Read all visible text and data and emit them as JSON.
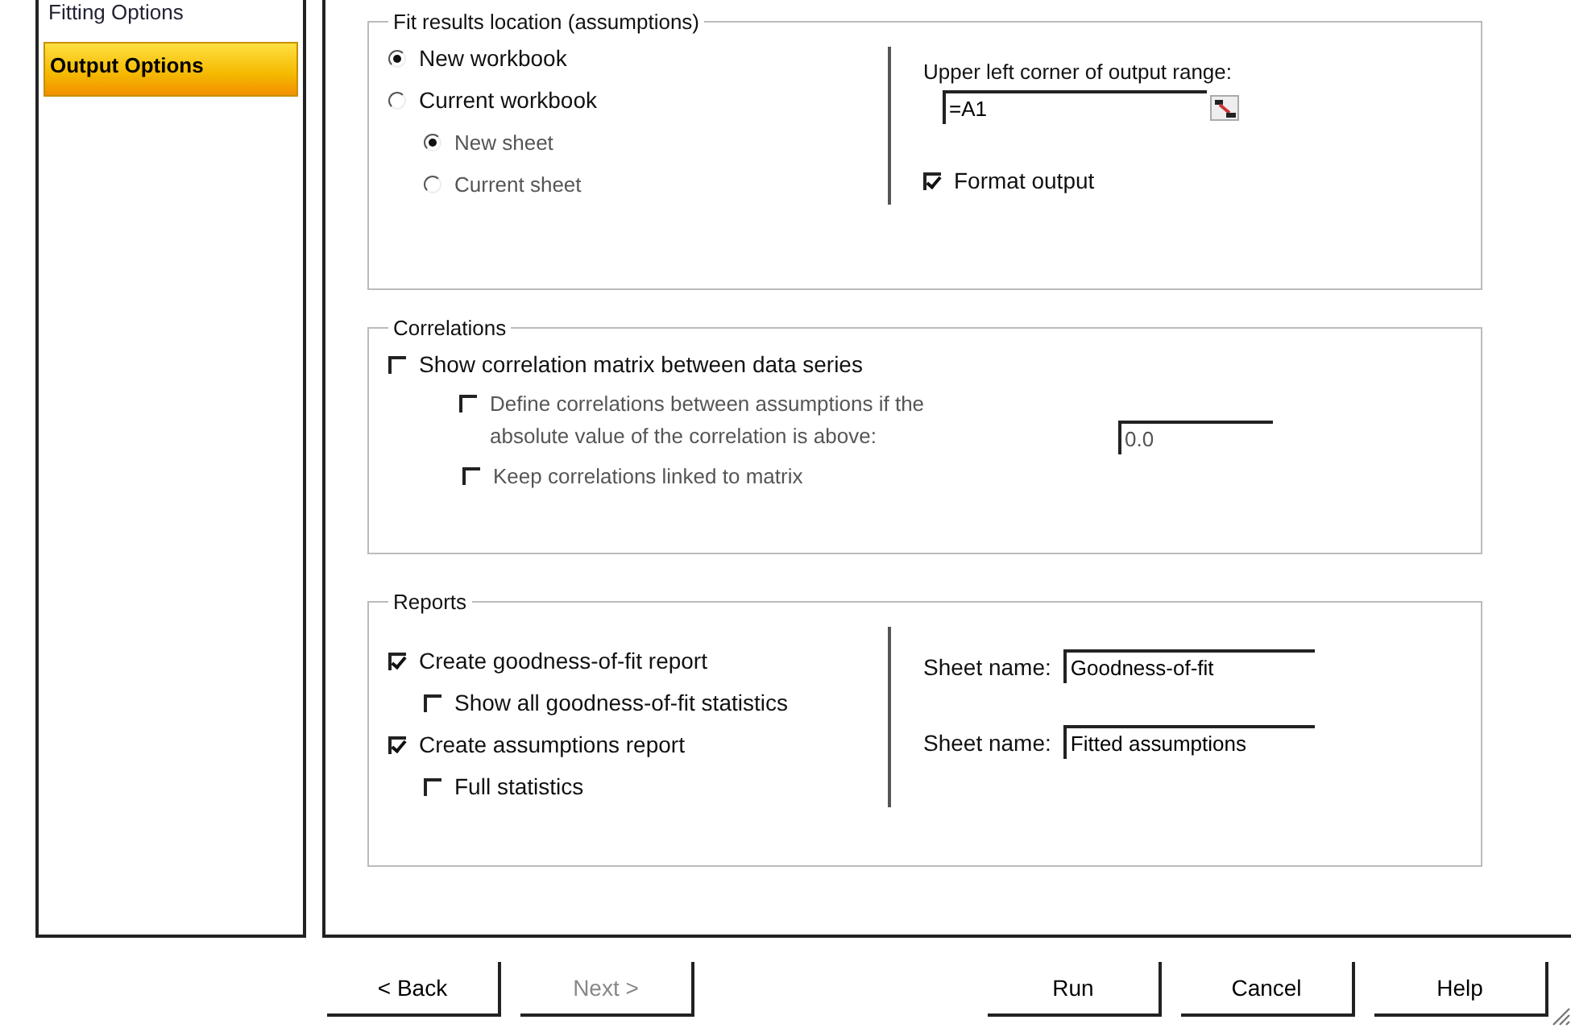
{
  "sidebar": {
    "items": [
      {
        "label": "Fitting Options",
        "selected": false
      },
      {
        "label": "Output Options",
        "selected": true
      }
    ]
  },
  "fit_results": {
    "title": "Fit results location (assumptions)",
    "location_options": [
      {
        "label": "New workbook",
        "selected": true
      },
      {
        "label": "Current workbook",
        "selected": false
      }
    ],
    "sheet_options": [
      {
        "label": "New sheet",
        "selected": true
      },
      {
        "label": "Current sheet",
        "selected": false
      }
    ],
    "range_label": "Upper left corner of output range:",
    "range_value": "=A1",
    "format_output": {
      "label": "Format output",
      "checked": true
    }
  },
  "correlations": {
    "title": "Correlations",
    "show_matrix": {
      "label": "Show correlation matrix between data series",
      "checked": false,
      "disabled": false
    },
    "define": {
      "label": "Define correlations between assumptions if the absolute value of the correlation is above:",
      "checked": false,
      "disabled": true
    },
    "threshold_value": "0.0",
    "keep_linked": {
      "label": "Keep correlations linked to matrix",
      "checked": false,
      "disabled": true
    }
  },
  "reports": {
    "title": "Reports",
    "items": [
      {
        "label": "Create goodness-of-fit report",
        "checked": true,
        "sheet_label": "Sheet name:",
        "sheet_value": "Goodness-of-fit",
        "children": [
          {
            "label": "Show all goodness-of-fit statistics",
            "checked": false
          }
        ]
      },
      {
        "label": "Create assumptions report",
        "checked": true,
        "sheet_label": "Sheet name:",
        "sheet_value": "Fitted assumptions",
        "children": [
          {
            "label": "Full statistics",
            "checked": false
          }
        ]
      }
    ]
  },
  "buttons": [
    {
      "label": "< Back",
      "disabled": false,
      "kind": "nav"
    },
    {
      "label": "Next >",
      "disabled": true,
      "kind": "nav"
    },
    {
      "label": "Run",
      "disabled": false,
      "kind": "action"
    },
    {
      "label": "Cancel",
      "disabled": false,
      "kind": "action"
    },
    {
      "label": "Help",
      "disabled": false,
      "kind": "action"
    }
  ]
}
